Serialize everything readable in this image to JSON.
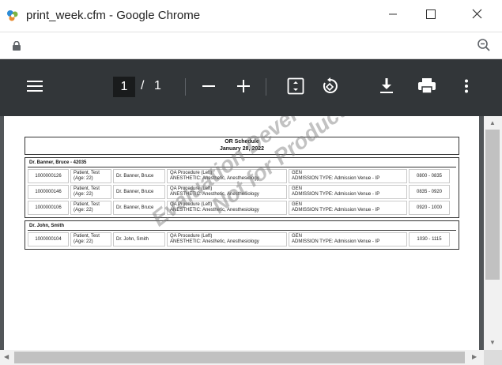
{
  "window": {
    "title": "print_week.cfm - Google Chrome",
    "icons": {
      "app": "chrome-app-icon",
      "minimize": "minimize-icon",
      "maximize": "maximize-icon",
      "close": "close-icon"
    }
  },
  "addressbar": {
    "lock_icon": "lock-icon",
    "zoom_icon": "zoom-out-icon"
  },
  "pdf_toolbar": {
    "current_page": "1",
    "separator": "/",
    "total_pages": "1",
    "icons": [
      "menu-icon",
      "zoom-out-icon",
      "zoom-in-icon",
      "fit-page-icon",
      "rotate-icon",
      "download-icon",
      "print-icon",
      "more-icon"
    ]
  },
  "report": {
    "title": "OR Schedule",
    "date": "January 28, 2022",
    "groups": [
      {
        "doctor_header": "Dr. Banner, Bruce - 42035",
        "rows": [
          {
            "id": "1000000126",
            "patient": "Patient, Test",
            "age": "(Age: 22)",
            "doctor": "Dr. Banner, Bruce",
            "procedure": "QA Procedure (Left)",
            "anesthetic": "ANESTHETIC: Anesthetic, Anesthesiology",
            "service": "GEN",
            "admission": "ADMISSION TYPE: Admission Venue - IP",
            "time": "0800 - 0835"
          },
          {
            "id": "1000000146",
            "patient": "Patient, Test",
            "age": "(Age: 22)",
            "doctor": "Dr. Banner, Bruce",
            "procedure": "QA Procedure (Left)",
            "anesthetic": "ANESTHETIC: Anesthetic, Anesthesiology",
            "service": "GEN",
            "admission": "ADMISSION TYPE: Admission Venue - IP",
            "time": "0835 - 0920"
          },
          {
            "id": "1000000106",
            "patient": "Patient, Test",
            "age": "(Age: 22)",
            "doctor": "Dr. Banner, Bruce",
            "procedure": "QA Procedure (Left)",
            "anesthetic": "ANESTHETIC: Anesthetic, Anesthesiology",
            "service": "GEN",
            "admission": "ADMISSION TYPE: Admission Venue - IP",
            "time": "0920 - 1000"
          }
        ]
      },
      {
        "doctor_header": "Dr. John, Smith",
        "rows": [
          {
            "id": "1000000104",
            "patient": "Patient, Test",
            "age": "(Age: 22)",
            "doctor": "Dr. John, Smith",
            "procedure": "QA Procedure (Left)",
            "anesthetic": "ANESTHETIC: Anesthetic, Anesthesiology",
            "service": "GEN",
            "admission": "ADMISSION TYPE: Admission Venue - IP",
            "time": "1030 - 1115"
          }
        ]
      }
    ],
    "watermark_line1": "Evaluation Developer/Trial Edition",
    "watermark_line2": "Not for Production Use"
  }
}
